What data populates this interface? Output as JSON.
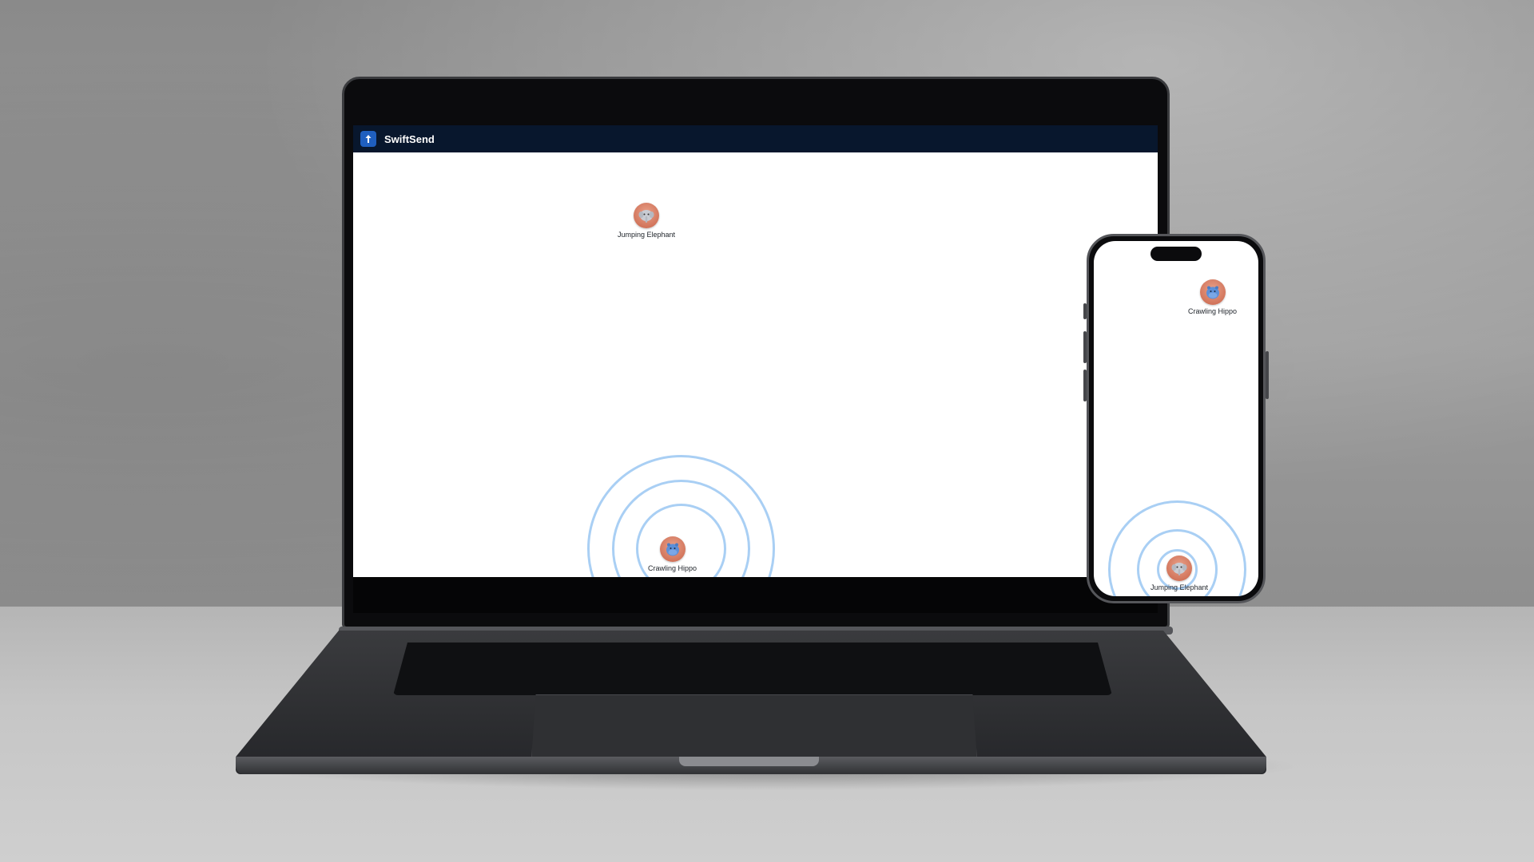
{
  "app": {
    "title": "SwiftSend",
    "logo_icon": "upload-arrow-icon",
    "accent_color": "#1f5fbf",
    "header_color": "#08172d",
    "pulse_color": "#a9cff4"
  },
  "laptop": {
    "peers": [
      {
        "name": "Jumping Elephant",
        "icon": "elephant-avatar-icon"
      }
    ],
    "self": {
      "name": "Crawling Hippo",
      "icon": "hippo-avatar-icon"
    }
  },
  "phone": {
    "peers": [
      {
        "name": "Crawling Hippo",
        "icon": "hippo-avatar-icon"
      }
    ],
    "self": {
      "name": "Jumping Elephant",
      "icon": "elephant-avatar-icon"
    }
  }
}
